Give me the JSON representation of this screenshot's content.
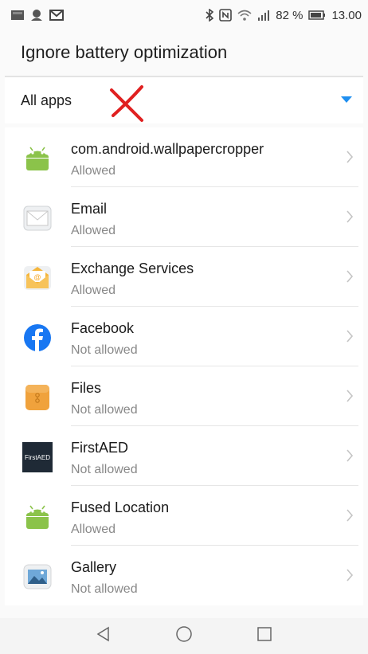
{
  "status_bar": {
    "battery_percent": "82 %",
    "time": "13.00",
    "icons": [
      "app-notification-icon",
      "messenger-icon",
      "mail-icon",
      "bluetooth-icon",
      "nfc-icon",
      "wifi-icon",
      "signal-icon",
      "battery-icon"
    ]
  },
  "header": {
    "title": "Ignore battery optimization"
  },
  "filter": {
    "label": "All apps"
  },
  "apps": [
    {
      "name": "com.android.wallpapercropper",
      "status": "Allowed",
      "icon": "android-icon"
    },
    {
      "name": "Email",
      "status": "Allowed",
      "icon": "email-icon"
    },
    {
      "name": "Exchange Services",
      "status": "Allowed",
      "icon": "exchange-icon"
    },
    {
      "name": "Facebook",
      "status": "Not allowed",
      "icon": "facebook-icon"
    },
    {
      "name": "Files",
      "status": "Not allowed",
      "icon": "files-icon"
    },
    {
      "name": "FirstAED",
      "status": "Not allowed",
      "icon": "firstaed-icon",
      "icon_text": "FirstAED"
    },
    {
      "name": "Fused Location",
      "status": "Allowed",
      "icon": "android-icon"
    },
    {
      "name": "Gallery",
      "status": "Not allowed",
      "icon": "gallery-icon"
    }
  ],
  "colors": {
    "accent": "#1f8ff0",
    "annotation_red": "#e02020",
    "android_green": "#8bc34a",
    "facebook_blue": "#1877f2"
  }
}
